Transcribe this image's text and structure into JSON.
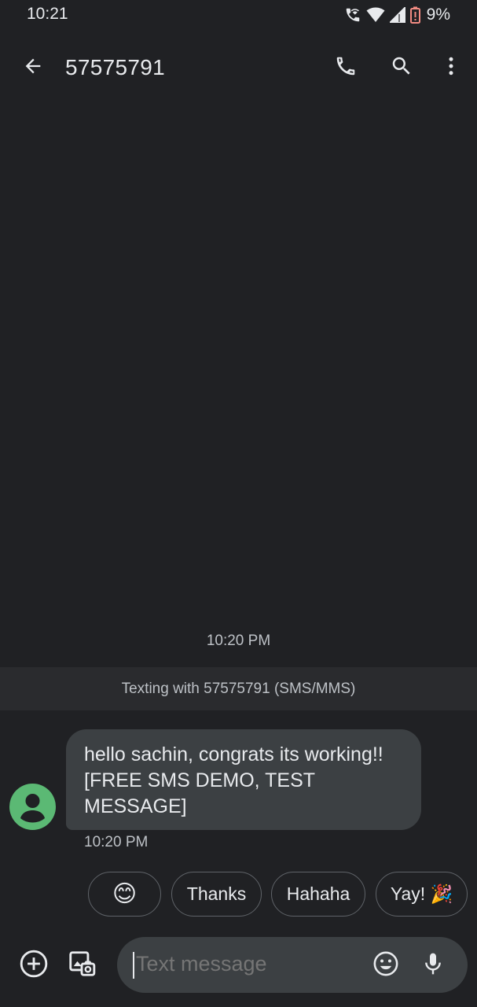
{
  "status_bar": {
    "time": "10:21",
    "battery_percent": "9%",
    "icons": [
      "wifi-call-icon",
      "wifi-icon",
      "signal-icon",
      "battery-low-icon"
    ]
  },
  "app_bar": {
    "title": "57575791",
    "icons": [
      "back-arrow-icon",
      "phone-icon",
      "search-icon",
      "more-vert-icon"
    ]
  },
  "conversation": {
    "timestamp": "10:20 PM",
    "banner": "Texting with 57575791 (SMS/MMS)",
    "messages": [
      {
        "text": "hello sachin, congrats its working!![FREE SMS DEMO, TEST MESSAGE]",
        "time": "10:20 PM",
        "direction": "incoming"
      }
    ]
  },
  "smart_replies": [
    {
      "label": "😊"
    },
    {
      "label": "Thanks"
    },
    {
      "label": "Hahaha"
    },
    {
      "label": "Yay! 🎉"
    }
  ],
  "compose": {
    "placeholder": "Text message",
    "icons": [
      "add-circle-icon",
      "gallery-icon",
      "emoji-icon",
      "mic-icon"
    ]
  },
  "colors": {
    "background": "#202124",
    "bubble": "#3c4043",
    "banner": "#2a2b2e",
    "avatar": "#5bb974",
    "battery_low": "#f28b82"
  }
}
